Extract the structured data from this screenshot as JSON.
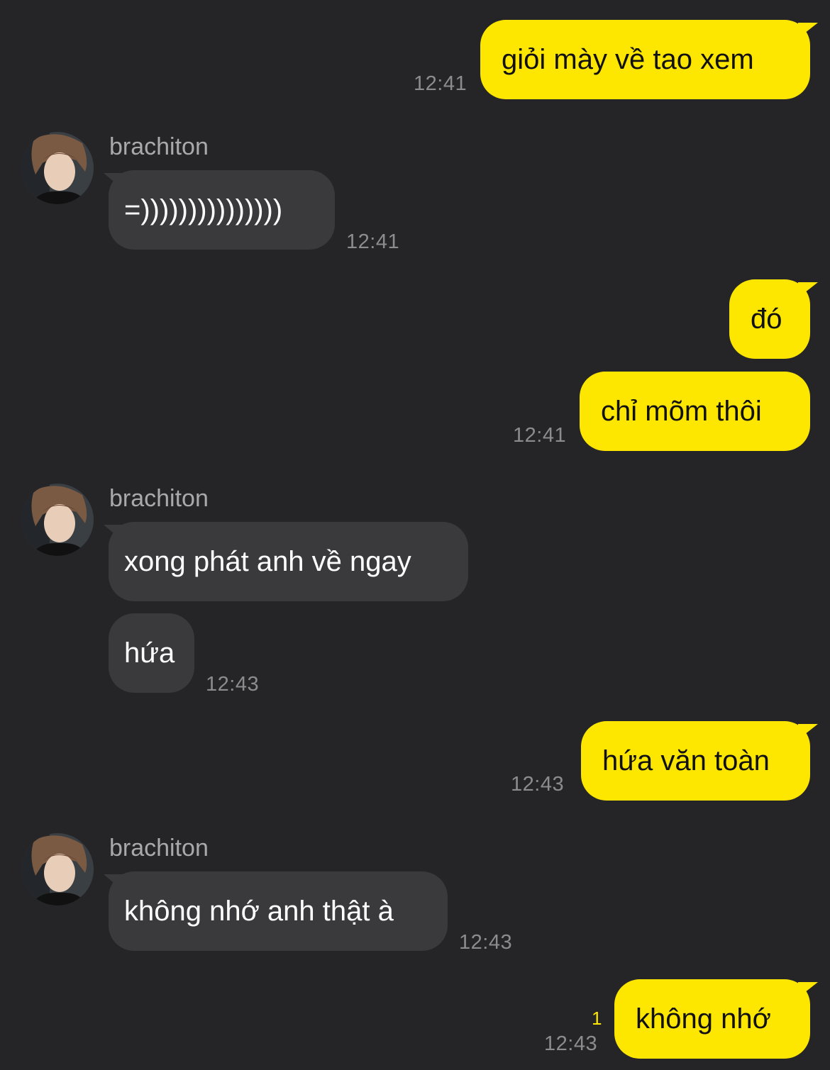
{
  "contact": {
    "name": "brachiton"
  },
  "messages": [
    {
      "from": "me",
      "text": "giỏi mày về tao xem",
      "time": "12:41"
    },
    {
      "from": "contact",
      "sender": "brachiton",
      "text": "=)))))))))))))))",
      "time": "12:41"
    },
    {
      "from": "me",
      "text": "đó"
    },
    {
      "from": "me",
      "text": "chỉ mõm thôi",
      "time": "12:41"
    },
    {
      "from": "contact",
      "sender": "brachiton",
      "text": "xong phát anh về ngay"
    },
    {
      "from": "contact",
      "text": "hứa",
      "time": "12:43"
    },
    {
      "from": "me",
      "text": "hứa văn toàn",
      "time": "12:43"
    },
    {
      "from": "contact",
      "sender": "brachiton",
      "text": "không nhớ anh thật à",
      "time": "12:43"
    },
    {
      "from": "me",
      "text": "không nhớ",
      "time": "12:43",
      "unread": "1"
    }
  ],
  "colors": {
    "background": "#252527",
    "incoming_bubble": "#3a3a3c",
    "outgoing_bubble": "#fde600",
    "timestamp": "#8c8c8f"
  },
  "icons": {
    "avatar": "contact-avatar-photo"
  }
}
